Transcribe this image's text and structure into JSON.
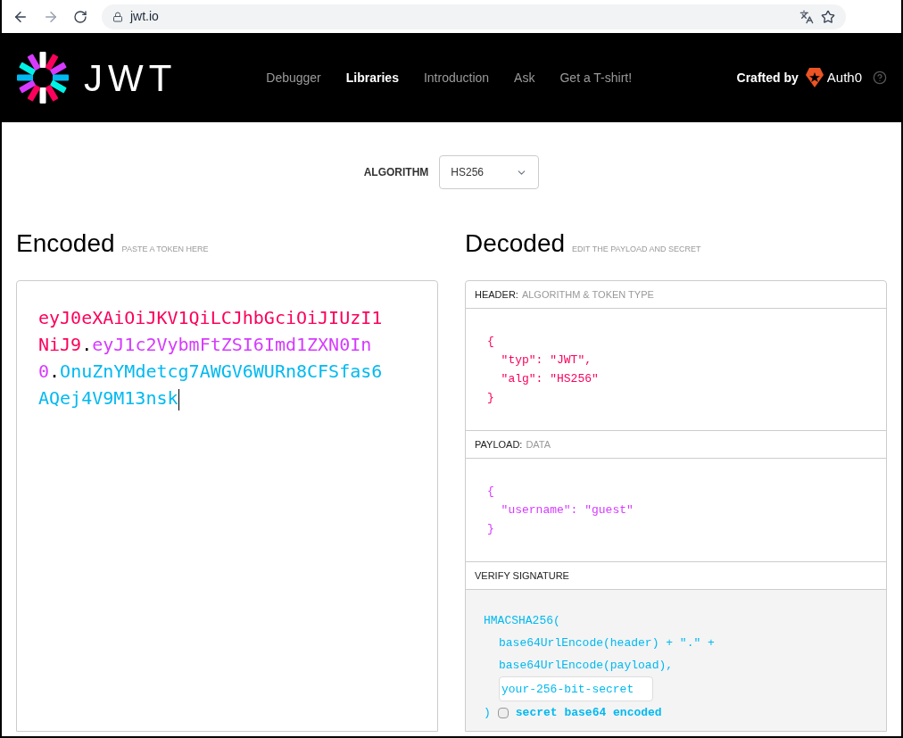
{
  "browser": {
    "url": "jwt.io"
  },
  "nav": {
    "logo_text": "JWT",
    "items": [
      {
        "label": "Debugger",
        "selected": false
      },
      {
        "label": "Libraries",
        "selected": true
      },
      {
        "label": "Introduction",
        "selected": false
      },
      {
        "label": "Ask",
        "selected": false
      },
      {
        "label": "Get a T-shirt!",
        "selected": false
      }
    ],
    "crafted_by": "Crafted by",
    "brand": "Auth0"
  },
  "algorithm": {
    "label": "ALGORITHM",
    "value": "HS256"
  },
  "encoded": {
    "title": "Encoded",
    "hint": "PASTE A TOKEN HERE",
    "token": [
      {
        "kind": "header",
        "text": "eyJ0eXAiOiJKV1QiLCJhbGciOiJIUzI1NiJ9"
      },
      {
        "kind": "dot",
        "text": "."
      },
      {
        "kind": "payload",
        "text": "eyJ1c2VybmFtZSI6Imd1ZXN0In0"
      },
      {
        "kind": "dot",
        "text": "."
      },
      {
        "kind": "signature",
        "text": "OnuZnYMdetcg7AWGV6WURn8CFSfas6AQej4V9M13nsk"
      }
    ]
  },
  "decoded": {
    "title": "Decoded",
    "hint": "EDIT THE PAYLOAD AND SECRET",
    "sections": [
      {
        "title": "HEADER:",
        "subtitle": "ALGORITHM & TOKEN TYPE",
        "color": "#fb015b",
        "code": "{\n  \"typ\": \"JWT\",\n  \"alg\": \"HS256\"\n}"
      },
      {
        "title": "PAYLOAD:",
        "subtitle": "DATA",
        "color": "#d63aff",
        "code": "{\n  \"username\": \"guest\"\n}"
      }
    ],
    "signature": {
      "title": "VERIFY SIGNATURE",
      "lines": [
        "HMACSHA256(",
        "base64UrlEncode(header) + \".\" +",
        "base64UrlEncode(payload),"
      ],
      "secret": "your-256-bit-secret",
      "close": ")",
      "checkbox": {
        "label": "secret base64 encoded",
        "checked": false
      }
    }
  }
}
